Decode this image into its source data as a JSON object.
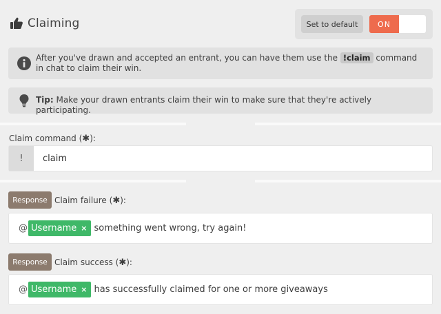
{
  "header": {
    "title": "Claiming",
    "set_default_label": "Set to default",
    "toggle_label": "ON"
  },
  "info": {
    "claim_text_before": "After you've drawn and accepted an entrant, you can have them use the",
    "claim_command": "!claim",
    "claim_text_after": "command in chat to claim their win.",
    "tip_label": "Tip:",
    "tip_text": "Make your drawn entrants claim their win to make sure that they're actively participating."
  },
  "claim_command": {
    "label": "Claim command (",
    "label_end": "):",
    "required_mark": "✱",
    "prefix": "!",
    "value": "claim"
  },
  "claim_failure": {
    "button_label": "Response",
    "label": "Claim failure (",
    "label_end": "):",
    "required_mark": "✱",
    "at": "@",
    "variable": "Username",
    "remove_mark": "×",
    "message": "something went wrong, try again!"
  },
  "claim_success": {
    "button_label": "Response",
    "label": "Claim success (",
    "label_end": "):",
    "required_mark": "✱",
    "at": "@",
    "variable": "Username",
    "remove_mark": "×",
    "message": "has successfully claimed for one or more giveaways"
  },
  "colors": {
    "toggle_on": "#ee6b4d",
    "response_button": "#8c7b6e",
    "variable_chip": "#3fb868"
  },
  "icons": {
    "title": "thumbs-up-icon",
    "info": "info-circle-icon",
    "tip": "lightbulb-icon"
  }
}
